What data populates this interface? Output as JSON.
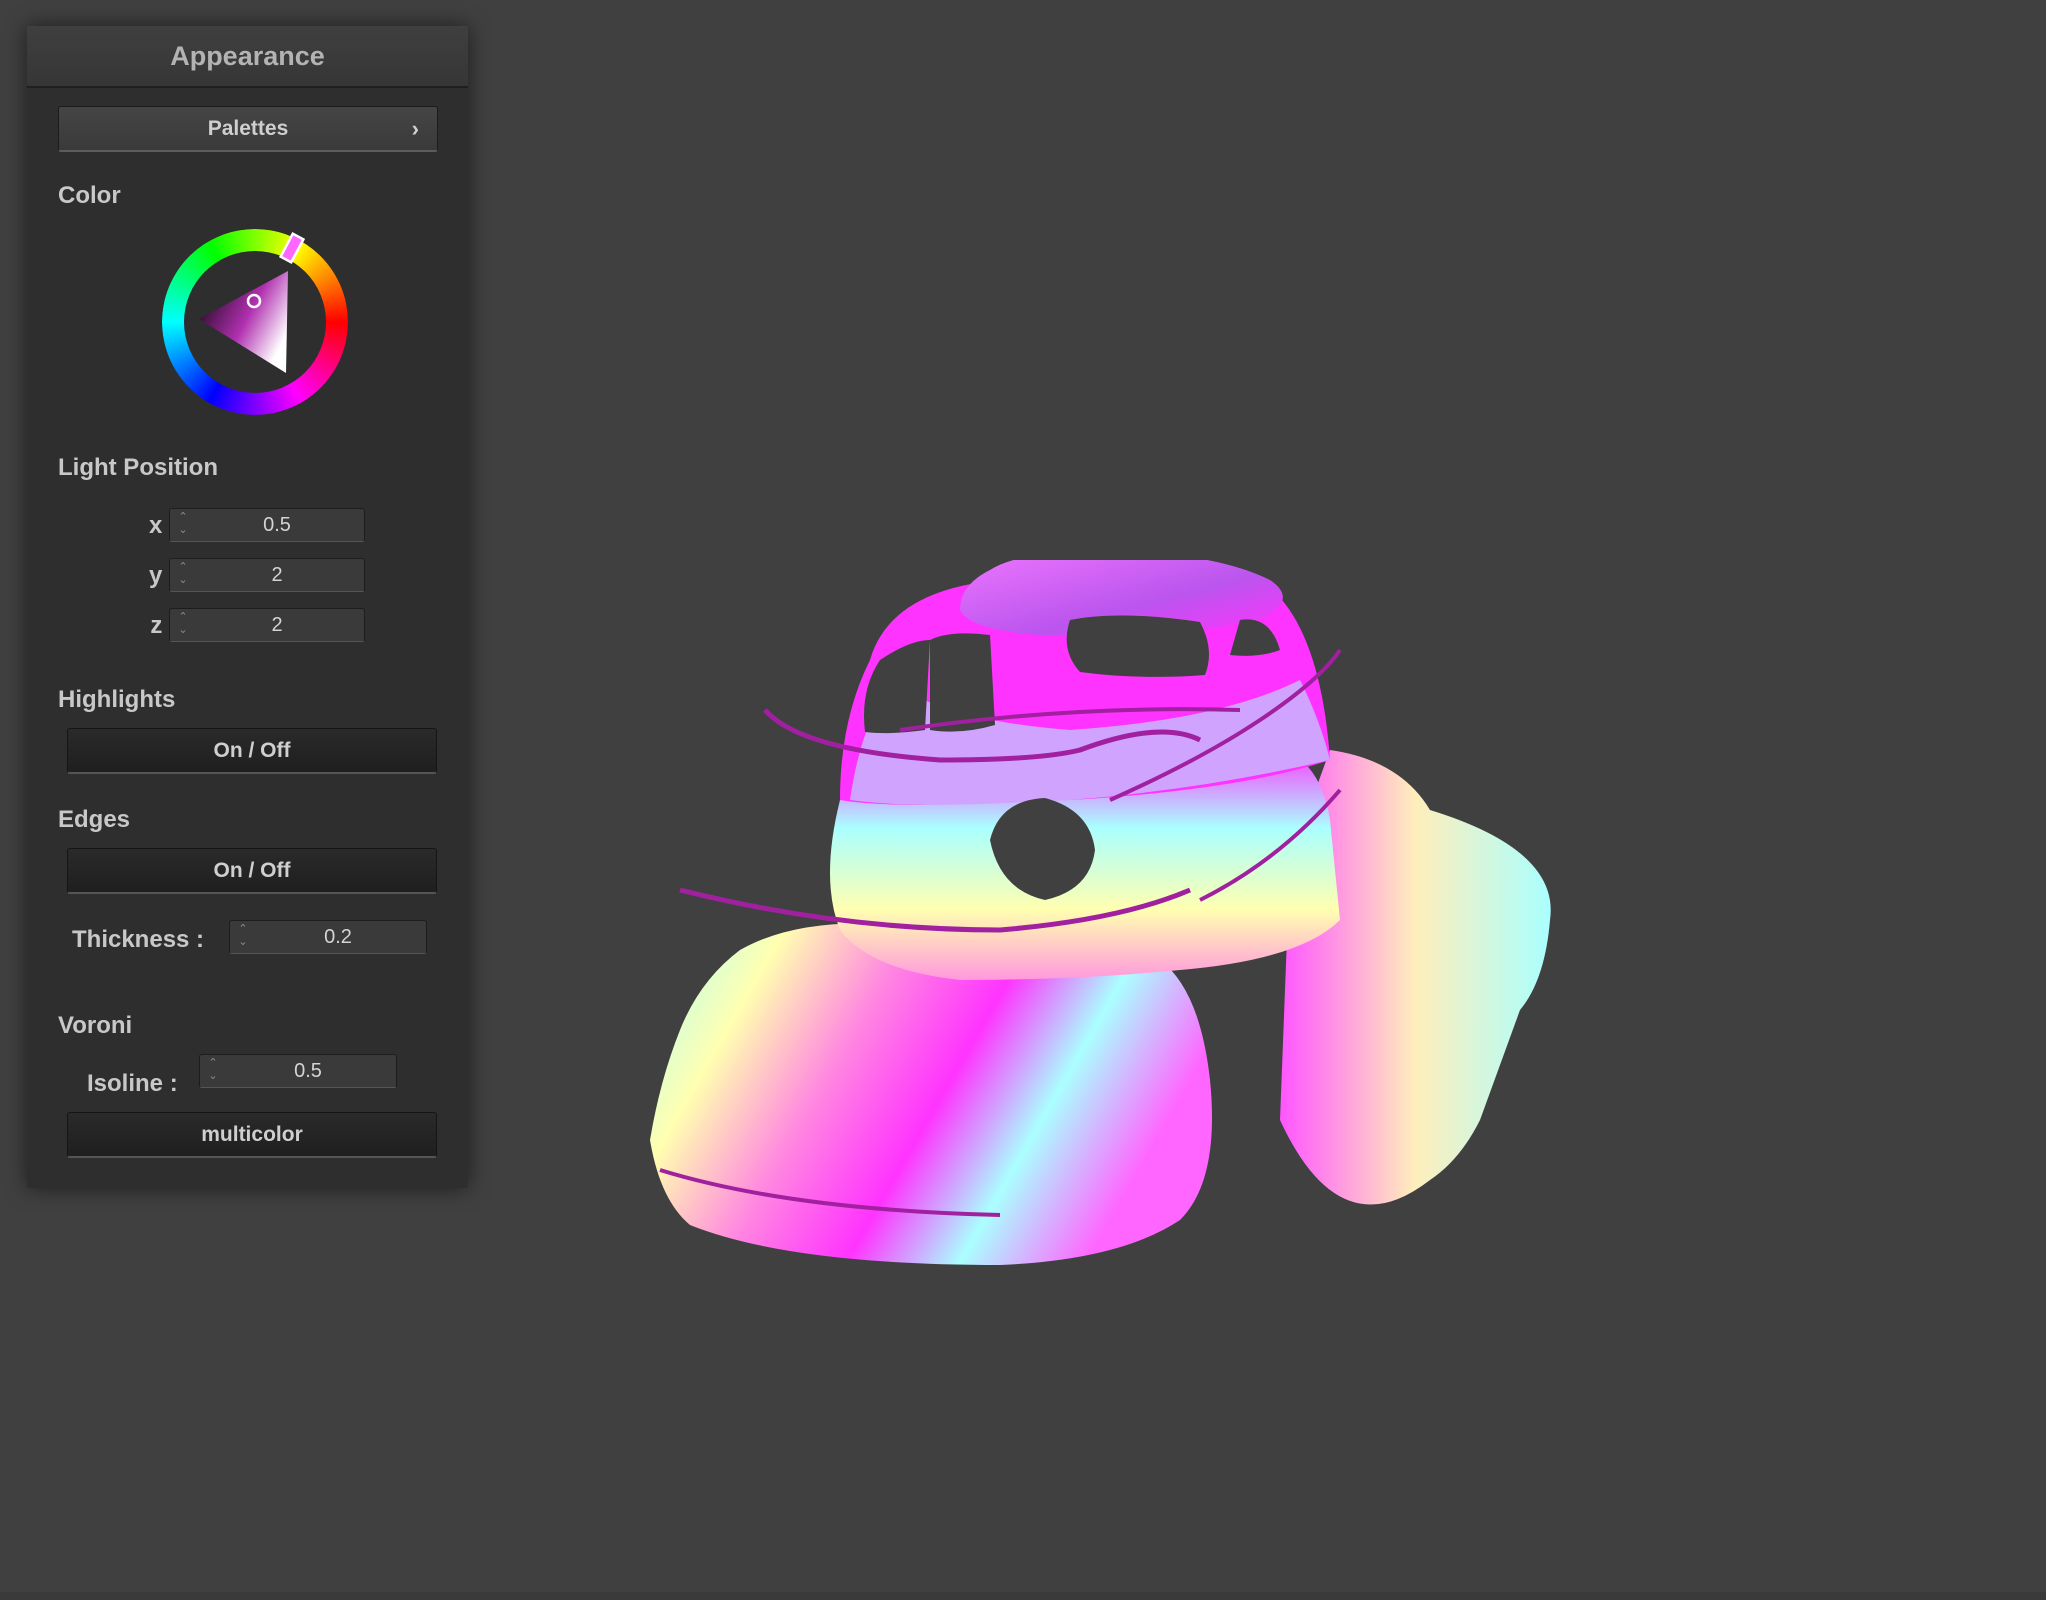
{
  "panel": {
    "title": "Appearance",
    "palettes_label": "Palettes",
    "chevron": "›",
    "color_label": "Color",
    "light_position": {
      "label": "Light Position",
      "x_label": "x :",
      "x_value": "0.5",
      "y_label": "y :",
      "y_value": "2",
      "z_label": "z :",
      "z_value": "2"
    },
    "highlights": {
      "label": "Highlights",
      "toggle_label": "On / Off"
    },
    "edges": {
      "label": "Edges",
      "toggle_label": "On / Off",
      "thickness_label": "Thickness :",
      "thickness_value": "0.2"
    },
    "voronoi": {
      "label": "Voroni",
      "isoline_label": "Isoline :",
      "isoline_value": "0.5",
      "mode_label": "multicolor"
    }
  },
  "colors": {
    "selected_hue": "#ff33ff",
    "background": "#404040",
    "panel": "#2e2e2e"
  },
  "icons": {
    "spin_up": "⌃",
    "spin_down": "⌄"
  }
}
